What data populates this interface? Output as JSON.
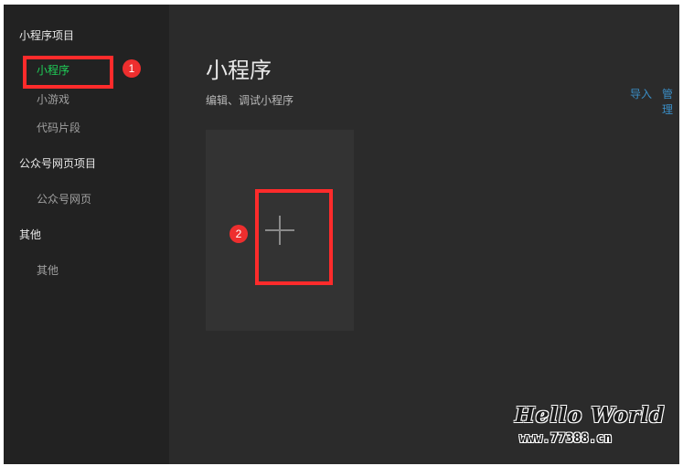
{
  "sidebar": {
    "groups": [
      {
        "title": "小程序项目",
        "items": [
          "小程序",
          "小游戏",
          "代码片段"
        ]
      },
      {
        "title": "公众号网页项目",
        "items": [
          "公众号网页"
        ]
      },
      {
        "title": "其他",
        "items": [
          "其他"
        ]
      }
    ],
    "active_item": "小程序"
  },
  "main": {
    "title": "小程序",
    "subtitle": "编辑、调试小程序",
    "links": {
      "import": "导入",
      "manage": "管理"
    },
    "add_card_icon": "plus-icon"
  },
  "annotations": {
    "badge_1": "1",
    "badge_2": "2",
    "highlight_color": "#ff2b2b"
  },
  "watermark": {
    "title": "Hello World",
    "url": "www.77388.cn"
  },
  "colors": {
    "sidebar_bg": "#222222",
    "main_bg": "#2b2b2b",
    "active": "#1fcf58",
    "link": "#3a8ec6"
  }
}
